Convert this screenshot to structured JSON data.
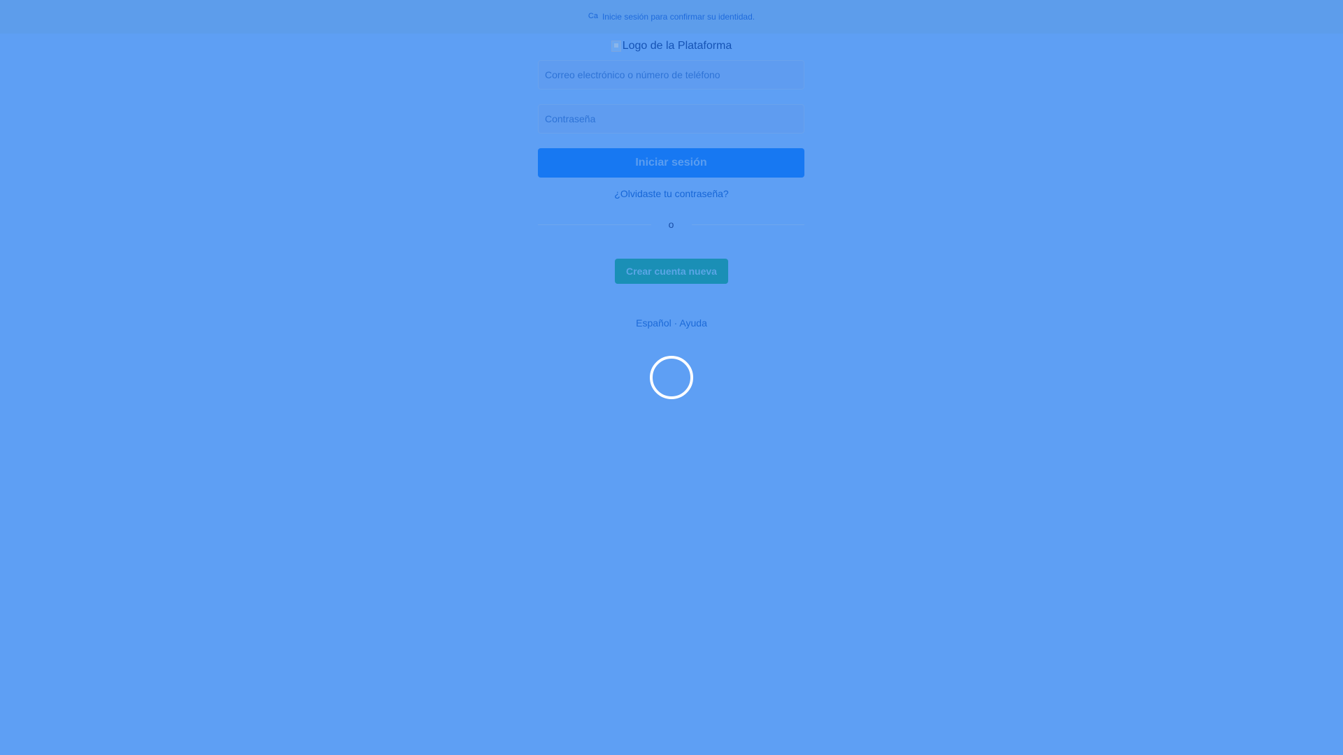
{
  "topbar": {
    "prefix": "Ca",
    "message": "Inicie sesión para confirmar su identidad."
  },
  "logo": {
    "alt_text": "Logo de la Plataforma"
  },
  "form": {
    "email_placeholder": "Correo electrónico o número de teléfono",
    "email_value": "",
    "password_placeholder": "Contraseña",
    "password_value": "",
    "login_label": "Iniciar sesión",
    "forgot_label": "¿Olvidaste tu contraseña?",
    "divider_label": "o",
    "create_label": "Crear cuenta nueva"
  },
  "footer": {
    "language": "Español",
    "separator": "·",
    "help": "Ayuda"
  },
  "icons": {
    "broken_image": "broken-image-icon",
    "spinner": "loading-spinner-icon"
  }
}
